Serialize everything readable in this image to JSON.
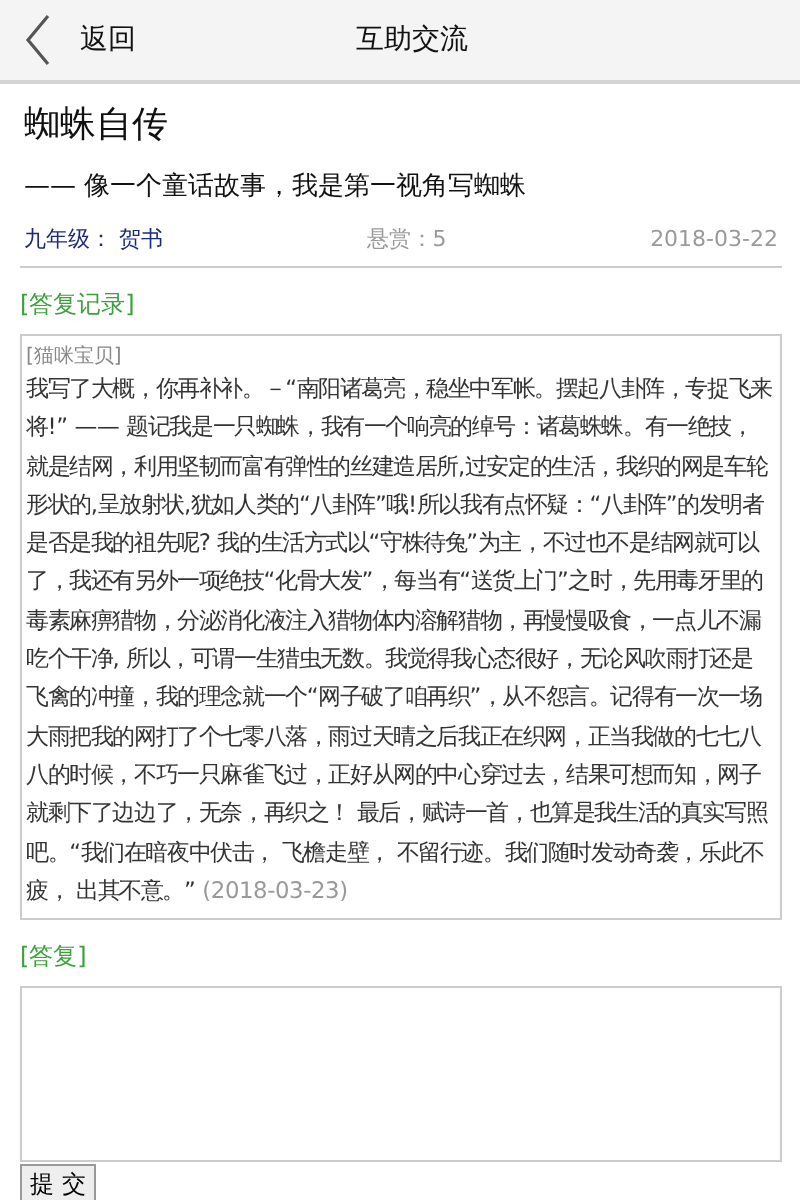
{
  "header": {
    "back_label": "返回",
    "title": "互助交流"
  },
  "question": {
    "title": "蜘蛛自传",
    "subtitle": "—— 像一个童话故事，我是第一视角写蜘蛛",
    "grade": "九年级：",
    "author": "贺书",
    "reward": "悬赏：5",
    "date": "2018-03-22"
  },
  "answers_heading": "[答复记录]",
  "answers": [
    {
      "author": "[猫咪宝贝]",
      "text": "我写了大概，你再补补。－“南阳诸葛亮，稳坐中军帐。摆起八卦阵，专捉飞来将!” —— 题记我是一只蜘蛛，我有一个响亮的绰号：诸葛蛛蛛。有一绝技，就是结网，利用坚韧而富有弹性的丝建造居所,过安定的生活，我织的网是车轮形状的,呈放射状,犹如人类的“八卦阵”哦!所以我有点怀疑：“八卦阵”的发明者是否是我的祖先呢? 我的生活方式以“守株待兔”为主，不过也不是结网就可以了，我还有另外一项绝技“化骨大发”，每当有“送货上门”之时，先用毒牙里的毒素麻痹猎物，分泌消化液注入猎物体内溶解猎物，再慢慢吸食，一点儿不漏吃个干净, 所以，可谓一生猎虫无数。我觉得我心态很好，无论风吹雨打还是飞禽的冲撞，我的理念就一个“网子破了咱再织”，从不怨言。记得有一次一场大雨把我的网打了个七零八落，雨过天晴之后我正在织网，正当我做的七七八八的时候，不巧一只麻雀飞过，正好从网的中心穿过去，结果可想而知，网子就剩下了边边了，无奈，再织之！ 最后，赋诗一首，也算是我生活的真实写照吧。“我们在暗夜中伏击， 飞檐走壁， 不留行迹。我们随时发动奇袭，乐此不疲， 出其不意。”",
      "date": "(2018-03-23)"
    }
  ],
  "reply": {
    "heading": "[答复]",
    "submit": "提 交"
  }
}
